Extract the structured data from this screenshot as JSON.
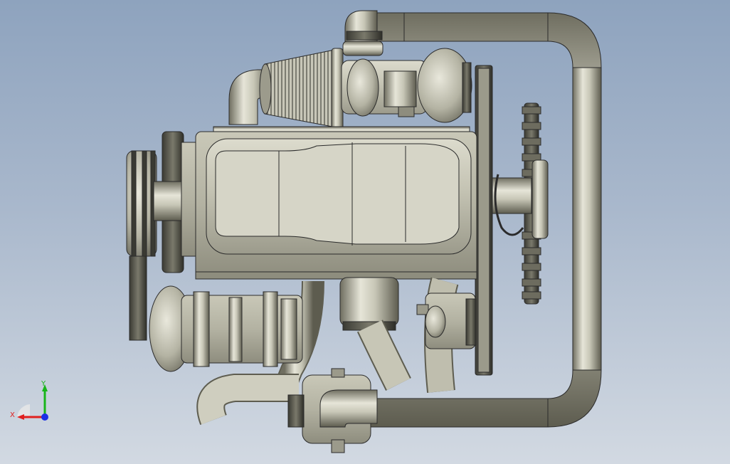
{
  "viewport": {
    "background_top": "#8ea3be",
    "background_bottom": "#d2d9e2"
  },
  "model": {
    "body_color": "#b9b8a6",
    "edge_color": "#2b2b2b"
  },
  "triad": {
    "x_label": "X",
    "y_label": "Y",
    "x_color": "#e0201f",
    "y_color": "#18b51a",
    "z_color": "#1c2fe6"
  }
}
